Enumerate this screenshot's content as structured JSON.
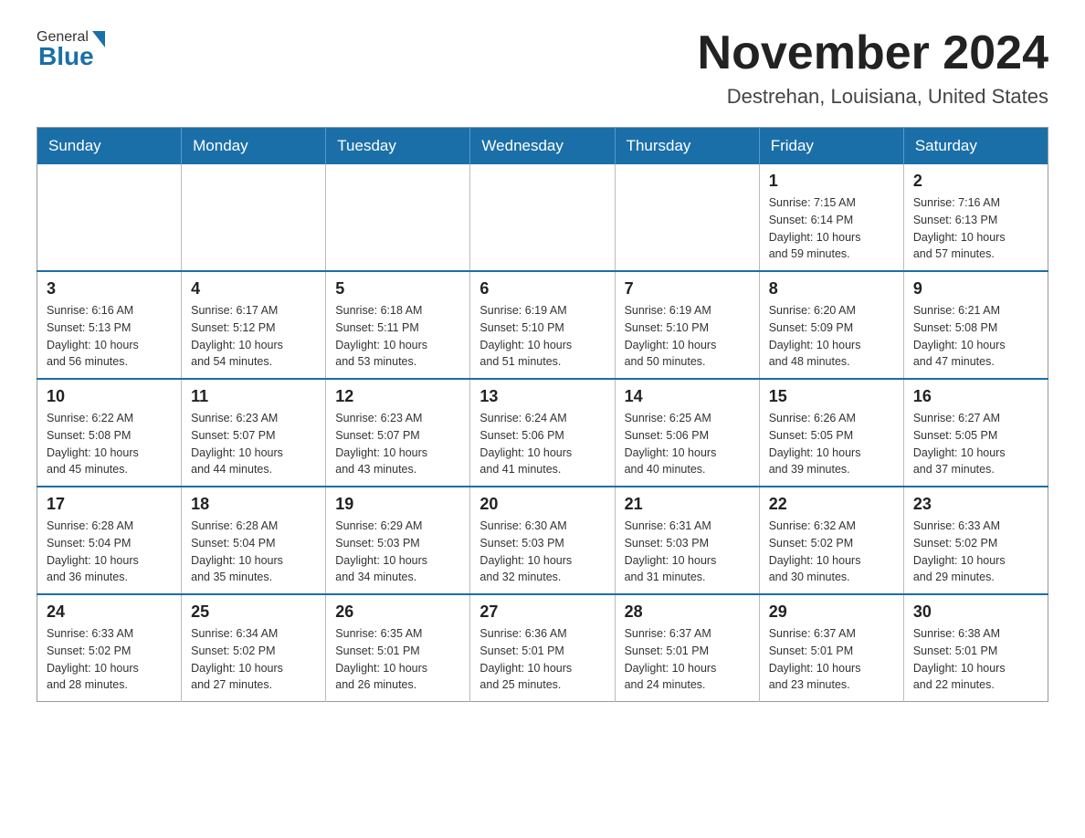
{
  "header": {
    "logo_general": "General",
    "logo_blue": "Blue",
    "month_title": "November 2024",
    "location": "Destrehan, Louisiana, United States"
  },
  "weekdays": [
    "Sunday",
    "Monday",
    "Tuesday",
    "Wednesday",
    "Thursday",
    "Friday",
    "Saturday"
  ],
  "weeks": [
    [
      {
        "day": "",
        "info": ""
      },
      {
        "day": "",
        "info": ""
      },
      {
        "day": "",
        "info": ""
      },
      {
        "day": "",
        "info": ""
      },
      {
        "day": "",
        "info": ""
      },
      {
        "day": "1",
        "info": "Sunrise: 7:15 AM\nSunset: 6:14 PM\nDaylight: 10 hours\nand 59 minutes."
      },
      {
        "day": "2",
        "info": "Sunrise: 7:16 AM\nSunset: 6:13 PM\nDaylight: 10 hours\nand 57 minutes."
      }
    ],
    [
      {
        "day": "3",
        "info": "Sunrise: 6:16 AM\nSunset: 5:13 PM\nDaylight: 10 hours\nand 56 minutes."
      },
      {
        "day": "4",
        "info": "Sunrise: 6:17 AM\nSunset: 5:12 PM\nDaylight: 10 hours\nand 54 minutes."
      },
      {
        "day": "5",
        "info": "Sunrise: 6:18 AM\nSunset: 5:11 PM\nDaylight: 10 hours\nand 53 minutes."
      },
      {
        "day": "6",
        "info": "Sunrise: 6:19 AM\nSunset: 5:10 PM\nDaylight: 10 hours\nand 51 minutes."
      },
      {
        "day": "7",
        "info": "Sunrise: 6:19 AM\nSunset: 5:10 PM\nDaylight: 10 hours\nand 50 minutes."
      },
      {
        "day": "8",
        "info": "Sunrise: 6:20 AM\nSunset: 5:09 PM\nDaylight: 10 hours\nand 48 minutes."
      },
      {
        "day": "9",
        "info": "Sunrise: 6:21 AM\nSunset: 5:08 PM\nDaylight: 10 hours\nand 47 minutes."
      }
    ],
    [
      {
        "day": "10",
        "info": "Sunrise: 6:22 AM\nSunset: 5:08 PM\nDaylight: 10 hours\nand 45 minutes."
      },
      {
        "day": "11",
        "info": "Sunrise: 6:23 AM\nSunset: 5:07 PM\nDaylight: 10 hours\nand 44 minutes."
      },
      {
        "day": "12",
        "info": "Sunrise: 6:23 AM\nSunset: 5:07 PM\nDaylight: 10 hours\nand 43 minutes."
      },
      {
        "day": "13",
        "info": "Sunrise: 6:24 AM\nSunset: 5:06 PM\nDaylight: 10 hours\nand 41 minutes."
      },
      {
        "day": "14",
        "info": "Sunrise: 6:25 AM\nSunset: 5:06 PM\nDaylight: 10 hours\nand 40 minutes."
      },
      {
        "day": "15",
        "info": "Sunrise: 6:26 AM\nSunset: 5:05 PM\nDaylight: 10 hours\nand 39 minutes."
      },
      {
        "day": "16",
        "info": "Sunrise: 6:27 AM\nSunset: 5:05 PM\nDaylight: 10 hours\nand 37 minutes."
      }
    ],
    [
      {
        "day": "17",
        "info": "Sunrise: 6:28 AM\nSunset: 5:04 PM\nDaylight: 10 hours\nand 36 minutes."
      },
      {
        "day": "18",
        "info": "Sunrise: 6:28 AM\nSunset: 5:04 PM\nDaylight: 10 hours\nand 35 minutes."
      },
      {
        "day": "19",
        "info": "Sunrise: 6:29 AM\nSunset: 5:03 PM\nDaylight: 10 hours\nand 34 minutes."
      },
      {
        "day": "20",
        "info": "Sunrise: 6:30 AM\nSunset: 5:03 PM\nDaylight: 10 hours\nand 32 minutes."
      },
      {
        "day": "21",
        "info": "Sunrise: 6:31 AM\nSunset: 5:03 PM\nDaylight: 10 hours\nand 31 minutes."
      },
      {
        "day": "22",
        "info": "Sunrise: 6:32 AM\nSunset: 5:02 PM\nDaylight: 10 hours\nand 30 minutes."
      },
      {
        "day": "23",
        "info": "Sunrise: 6:33 AM\nSunset: 5:02 PM\nDaylight: 10 hours\nand 29 minutes."
      }
    ],
    [
      {
        "day": "24",
        "info": "Sunrise: 6:33 AM\nSunset: 5:02 PM\nDaylight: 10 hours\nand 28 minutes."
      },
      {
        "day": "25",
        "info": "Sunrise: 6:34 AM\nSunset: 5:02 PM\nDaylight: 10 hours\nand 27 minutes."
      },
      {
        "day": "26",
        "info": "Sunrise: 6:35 AM\nSunset: 5:01 PM\nDaylight: 10 hours\nand 26 minutes."
      },
      {
        "day": "27",
        "info": "Sunrise: 6:36 AM\nSunset: 5:01 PM\nDaylight: 10 hours\nand 25 minutes."
      },
      {
        "day": "28",
        "info": "Sunrise: 6:37 AM\nSunset: 5:01 PM\nDaylight: 10 hours\nand 24 minutes."
      },
      {
        "day": "29",
        "info": "Sunrise: 6:37 AM\nSunset: 5:01 PM\nDaylight: 10 hours\nand 23 minutes."
      },
      {
        "day": "30",
        "info": "Sunrise: 6:38 AM\nSunset: 5:01 PM\nDaylight: 10 hours\nand 22 minutes."
      }
    ]
  ]
}
